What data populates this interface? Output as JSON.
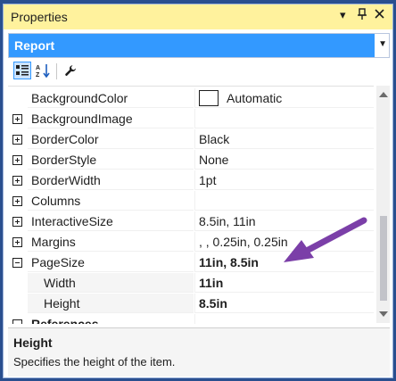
{
  "window": {
    "title": "Properties",
    "pin_glyph": "▾ ⊥ ✕"
  },
  "object_selector": {
    "value": "Report"
  },
  "toolbar": {
    "buttons": [
      "categorized-view",
      "alphabetical-view",
      "property-pages"
    ]
  },
  "properties": [
    {
      "name": "BackgroundColor",
      "value": "Automatic",
      "expander": "none",
      "swatch": "#ffffff"
    },
    {
      "name": "BackgroundImage",
      "value": "",
      "expander": "plus"
    },
    {
      "name": "BorderColor",
      "value": "Black",
      "expander": "plus"
    },
    {
      "name": "BorderStyle",
      "value": "None",
      "expander": "plus"
    },
    {
      "name": "BorderWidth",
      "value": "1pt",
      "expander": "plus"
    },
    {
      "name": "Columns",
      "value": "",
      "expander": "plus"
    },
    {
      "name": "InteractiveSize",
      "value": "8.5in, 11in",
      "expander": "plus"
    },
    {
      "name": "Margins",
      "value": ", , 0.25in, 0.25in",
      "expander": "plus"
    },
    {
      "name": "PageSize",
      "value": "11in, 8.5in",
      "expander": "minus",
      "bold_value": true
    },
    {
      "name": "Width",
      "value": "11in",
      "sub": true,
      "bold_value": true
    },
    {
      "name": "Height",
      "value": "8.5in",
      "sub": true,
      "bold_value": true
    },
    {
      "name": "References",
      "value": "",
      "expander": "minus",
      "category": true
    }
  ],
  "description": {
    "title": "Height",
    "text": "Specifies the height of the item."
  },
  "colors": {
    "title_bar": "#fff29d",
    "selection": "#3399ff",
    "frame": "#2a4f8f",
    "arrow": "#7b3fa8"
  }
}
